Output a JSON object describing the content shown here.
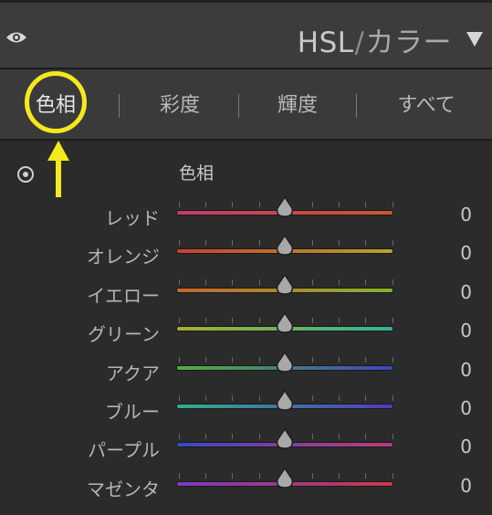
{
  "header": {
    "title_main": "HSL",
    "title_sep": "/",
    "title_sub": "カラー"
  },
  "tabs": [
    {
      "label": "色相",
      "active": true
    },
    {
      "label": "彩度",
      "active": false
    },
    {
      "label": "輝度",
      "active": false
    },
    {
      "label": "すべて",
      "active": false
    }
  ],
  "section": {
    "label": "色相"
  },
  "sliders": [
    {
      "label": "レッド",
      "value": "0",
      "gradient": [
        "#c23a6e",
        "#c8582e"
      ]
    },
    {
      "label": "オレンジ",
      "value": "0",
      "gradient": [
        "#c8402e",
        "#b6a42a"
      ]
    },
    {
      "label": "イエロー",
      "value": "0",
      "gradient": [
        "#c8662a",
        "#86b42c"
      ]
    },
    {
      "label": "グリーン",
      "value": "0",
      "gradient": [
        "#a8b02a",
        "#2fb59a"
      ]
    },
    {
      "label": "アクア",
      "value": "0",
      "gradient": [
        "#52b03a",
        "#3a48c0"
      ]
    },
    {
      "label": "ブルー",
      "value": "0",
      "gradient": [
        "#2fb08a",
        "#5238c0"
      ]
    },
    {
      "label": "パープル",
      "value": "0",
      "gradient": [
        "#3848c4",
        "#c03a7a"
      ]
    },
    {
      "label": "マゼンタ",
      "value": "0",
      "gradient": [
        "#7a3ac0",
        "#c83a4a"
      ]
    }
  ],
  "annotation_color": "#f5e81c"
}
